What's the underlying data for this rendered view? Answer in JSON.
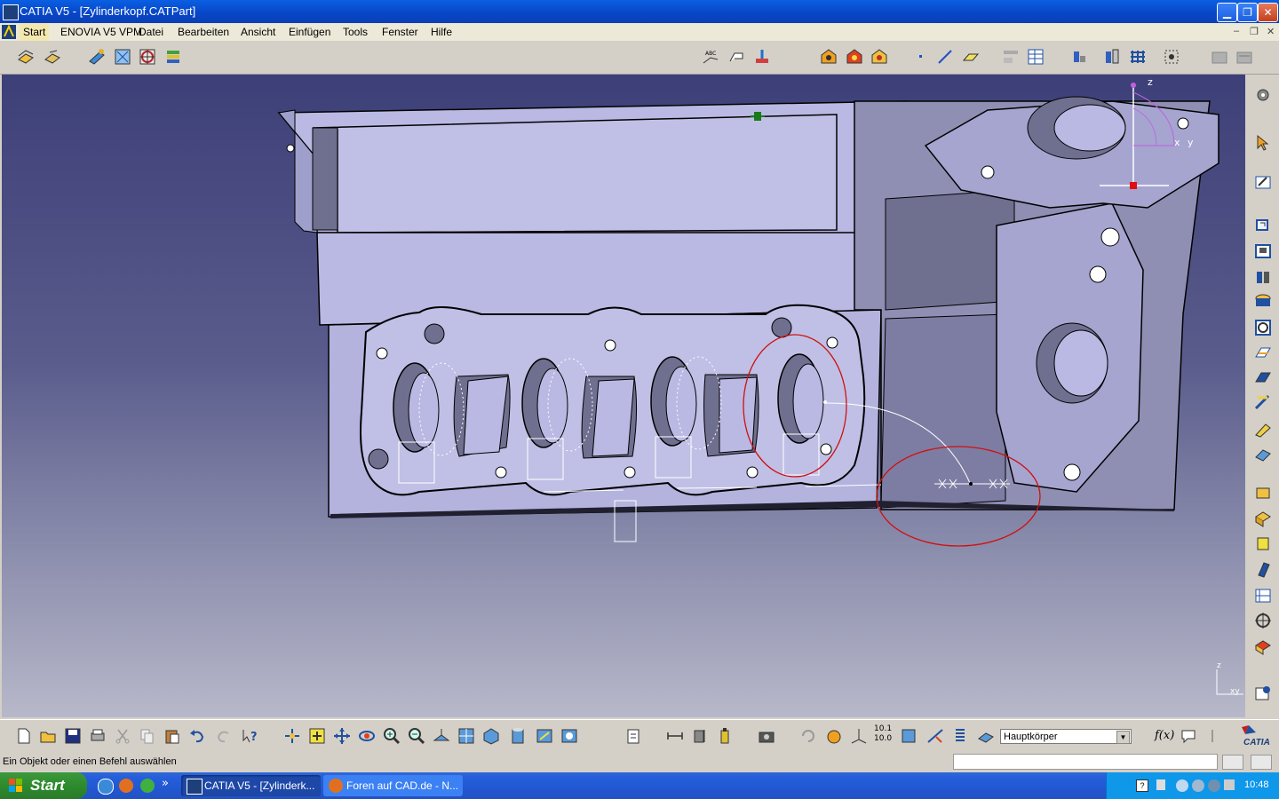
{
  "window": {
    "title": "CATIA V5 - [Zylinderkopf.CATPart]",
    "minimize_glyph": "▁",
    "restore_glyph": "❐",
    "close_glyph": "✕"
  },
  "menu": {
    "items": [
      {
        "label": "Start"
      },
      {
        "label": "ENOVIA V5 VPM"
      },
      {
        "label": "Datei"
      },
      {
        "label": "Bearbeiten"
      },
      {
        "label": "Ansicht"
      },
      {
        "label": "Einfügen"
      },
      {
        "label": "Tools"
      },
      {
        "label": "Fenster"
      },
      {
        "label": "Hilfe"
      }
    ],
    "mdi_minimize": "–",
    "mdi_restore": "❐",
    "mdi_close": "✕"
  },
  "viewport": {
    "compass_z": "z",
    "compass_x": "x",
    "compass_y": "y",
    "mini_axis_z": "z",
    "mini_axis_xy": "xy"
  },
  "bottom_toolbar": {
    "body_selector_value": "Hauptkörper",
    "formula_label": "f(x)",
    "catia_brand": "CATIA",
    "ruler_label_top": "10.1",
    "ruler_label_bottom": "10.0"
  },
  "status": {
    "message": "Ein Objekt oder einen Befehl auswählen"
  },
  "taskbar": {
    "start_label": "Start",
    "tasks": [
      {
        "label": "CATIA V5 - [Zylinderk..."
      },
      {
        "label": "Foren auf CAD.de - N..."
      }
    ],
    "quicklaunch_more": "»",
    "language": "DE",
    "clock": "10:48"
  },
  "colors": {
    "part_fill": "#b9b9e3",
    "part_shadow": "#6f6f8f",
    "part_edge": "#000000",
    "markup_circle": "#d01010",
    "sketch_white": "#ffffff"
  }
}
